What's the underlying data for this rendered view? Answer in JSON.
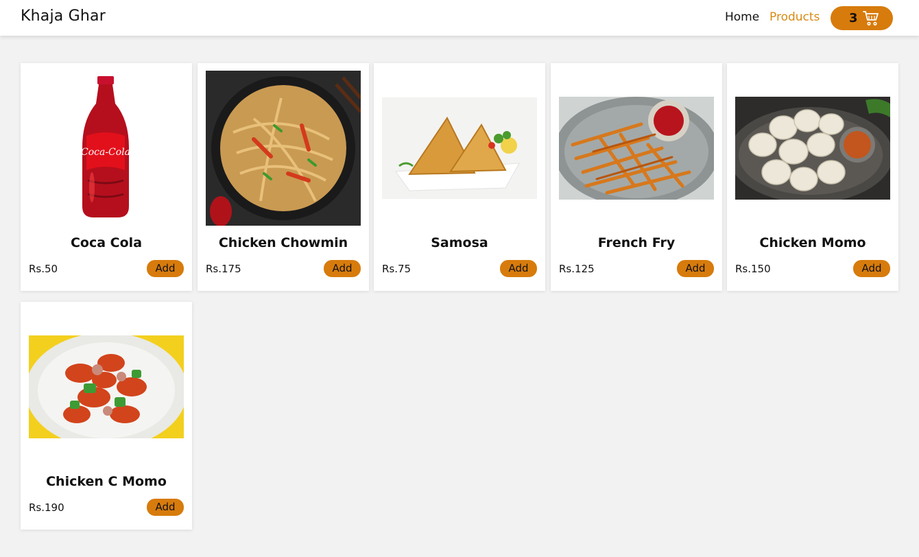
{
  "header": {
    "brand": "Khaja Ghar",
    "nav": {
      "home": "Home",
      "products": "Products"
    },
    "cart": {
      "count": "3",
      "icon": "cart-icon"
    }
  },
  "colors": {
    "accent": "#d77b0c",
    "active_link": "#d88a14"
  },
  "products": [
    {
      "name": "Coca Cola",
      "price": "Rs.50",
      "add_label": "Add",
      "image": "coca-cola-bottle-image"
    },
    {
      "name": "Chicken Chowmin",
      "price": "Rs.175",
      "add_label": "Add",
      "image": "chicken-chowmin-image"
    },
    {
      "name": "Samosa",
      "price": "Rs.75",
      "add_label": "Add",
      "image": "samosa-image"
    },
    {
      "name": "French Fry",
      "price": "Rs.125",
      "add_label": "Add",
      "image": "french-fry-image"
    },
    {
      "name": "Chicken Momo",
      "price": "Rs.150",
      "add_label": "Add",
      "image": "chicken-momo-image"
    },
    {
      "name": "Chicken C Momo",
      "price": "Rs.190",
      "add_label": "Add",
      "image": "chicken-c-momo-image"
    }
  ]
}
